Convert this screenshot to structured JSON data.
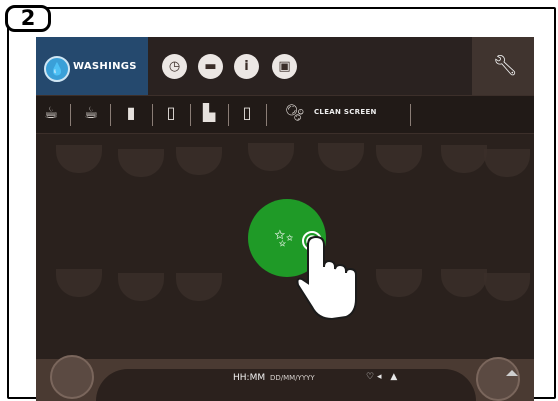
{
  "step_number": "2",
  "topbar": {
    "washings_label": "WASHINGS",
    "icons": [
      "clock-icon",
      "flag-icon",
      "info-icon",
      "machine-icon"
    ],
    "settings_icon": "wrench-icon"
  },
  "toolbar": {
    "icons": [
      "cup-rinse-icon",
      "cup-icon",
      "milk-jug-icon",
      "glass-icon",
      "machine-pour-icon",
      "glass-icon"
    ],
    "clean_label": "CLEAN SCREEN",
    "clean_icon": "clean-screen-icon"
  },
  "main": {
    "center_button_icon": "clean-screen-icon",
    "hand_icon": "tap-hand-icon"
  },
  "statusbar": {
    "time": "HH:MM",
    "date": "DD/MM/YYYY",
    "icons": [
      "heart-icon",
      "speaker-icon",
      "person-icon"
    ]
  },
  "colors": {
    "washings_bg": "#25496e",
    "green_button": "#1f9a27",
    "screen_bg": "#2a211d"
  }
}
